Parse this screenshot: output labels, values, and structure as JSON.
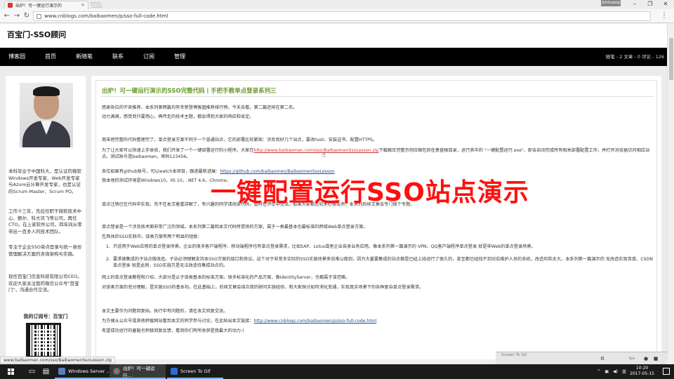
{
  "browser": {
    "tab_title": "出炉！可一键运行演示的",
    "user_badge": "Jchhuang",
    "url": "www.cnblogs.com/baibaomen/p/sso-full-code.html",
    "status_url": "www.baibaomen.com/sso/BaibaomenSsoLesson.zip"
  },
  "site": {
    "title": "百宝门-SSO顾问",
    "nav": [
      "博客园",
      "首页",
      "新随笔",
      "联系",
      "订阅",
      "管理"
    ],
    "stats": "随笔 - 2  文章 - 0  评论 - 126"
  },
  "sidebar": {
    "bio1": "本科毕业于中国科大，是认证的微软Windows开发专家、Web开发专家与Azure云计算开发专家，也是认证的Scrum Master、Scrum PO。",
    "bio2": "工作十三年，先后任职于微软技术中心、鲍尔、科大讯飞等公司，再任CTO。在上家软件公司，四年间从零带出一百多人的技术团队。",
    "bio3": "专注于企业SSO单点登录与统一身份管理解决方案的咨询架构与实施。",
    "bio4": "现任百宝门信息科技有限公司CEO。欢迎大家关注我的微信公众号\"百宝门\"，沟通合作交流。",
    "subscribe": "我的订阅号：百宝门"
  },
  "post": {
    "title": "出炉！可一键运行演示的SSO完整代码丨手把手教单点登录系列三",
    "p1": "感谢各位的不吝推荐，本系列第两篇均有幸荣登博客园推荐排行榜。今天去看，第二篇还排在第二名。",
    "p2": "动力满满，感受到只要用心，再传走的技术主题，都会得到大家的响应和肯定。",
    "p3": "周末把完整的代码整理完了。单点登录方案不同于一个普通站点，它的部署比较繁琐：涉及到好几个站点，要改host、安装证书、配置HTTPS。",
    "p4a": "为了让大家可以快速上手体验，我们开发了一个一键部署运行的小程序。大家在",
    "p4link": "http://www.baibaomen.com/sso/BaibaomenSsoLesson.zip",
    "p4b": "下载解压完整示例压缩包到任意盘根目录，运行其中的 \"一键配置运行.exe\"，即会自动完成所有相关部署配置工作，并打开浏览器访问相应站点。测试账号是baibaomen，密码123456。",
    "p5a": "各位如果有github账号，可以watch本项目，跟进最新进展：",
    "p5link": "https://github.com/baibaomen/BaibaomenSsoLesson",
    "p6": "我本地的测试环境是Windows10，IIS 10，.NET 4.6，Chrome。",
    "p7": "单点注销已在代码中实现。先不在本文着重讲解了，有兴趣的同学请阅读代码，暂时在评论中交流。如果大家都比较关心该业务，本系列后续文章会专门做个专题。",
    "p8": "单点登录是一个涉及技术面非常广泛的领域。本系列第二篇和本文代码所提供的方案，属于一类最基本也最标准的跨域Web单点登录方案。",
    "p9": "在具体的SSO实践中，该类方案有两个明显的短板：",
    "li1": "只适用于Web应用的单点登录场景。企业的很多客户端程序、移动端程序也有单点登录需求，比如SAP、Lotus或者企业自身业务应用。像本系列第一篇演示的 VPN、QQ客户端程序单点登录 就是非Web的单点登录场景。",
    "li2": "要求被集成的子站点做改造。子站必须理解支持本SSO方案的接口和协议。这个对于非常多实际的SSO实施场景来说难以做到，因为大量要集成的站点都是已经上线运行了很久的，甚至都已经找不到对应维护人员的系统，改造风险太大。本系列第一篇演示的 无改造实现百度、CSDN单点登录 就是此例，SSO实施方是无法改造待集成站点的。",
    "p10": "网上的单点登录教程和介绍，大部分是止于该类基本的标准方案。很多标准化的产品方案，像IdentityServer，也都属于该范畴。",
    "p11": "对该类方案的充分理解，是实施SSO的基本功。在此基础上，后续文章会结合我的顾问实施经验，和大家探讨如何消化变通，实现真实场景下的各种复杂单点登录需求。",
    "p12": "本文主要作为问题回复贴。执行中有问题的，请在本文回复交流。",
    "p13a": "为方便从公众号或其他转载网站看到本文的同学参与讨论，在此贴出本文链接：",
    "p13link": "http://www.cnblogs.com/baibaomen/p/sso-full-code.html",
    "p14": "希望成功运行的童鞋也积极回复反馈，看到你们有所收获是我最大的动力:)"
  },
  "overlay_text": "一键配置运行SSO站点演示",
  "gif_panel": {
    "title": "Screen To Gif",
    "fps": "fps"
  },
  "taskbar": {
    "tasks": [
      "Windows Server ...",
      "出炉！可一键运行...",
      "Screen To Gif"
    ],
    "time": "10:20",
    "date": "2017-05-15"
  }
}
